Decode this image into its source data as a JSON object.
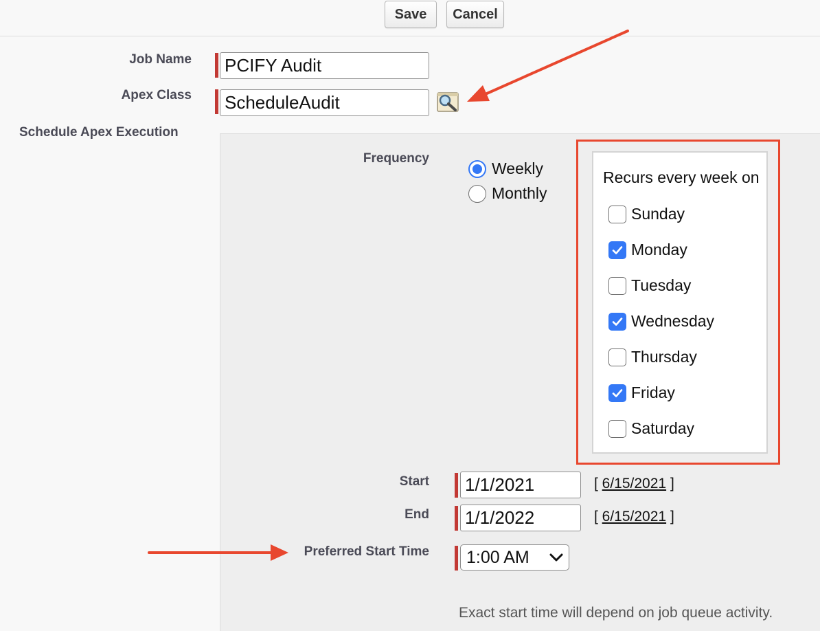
{
  "toolbar": {
    "save_label": "Save",
    "cancel_label": "Cancel"
  },
  "form": {
    "job_name": {
      "label": "Job Name",
      "value": "PCIFY Audit"
    },
    "apex_class": {
      "label": "Apex Class",
      "value": "ScheduleAudit",
      "lookup_icon": "lookup-magnifier-icon"
    },
    "schedule_label": "Schedule Apex Execution"
  },
  "schedule": {
    "frequency_label": "Frequency",
    "frequency_options": [
      {
        "label": "Weekly",
        "selected": true
      },
      {
        "label": "Monthly",
        "selected": false
      }
    ],
    "recurs_label": "Recurs every week on",
    "days": [
      {
        "label": "Sunday",
        "checked": false
      },
      {
        "label": "Monday",
        "checked": true
      },
      {
        "label": "Tuesday",
        "checked": false
      },
      {
        "label": "Wednesday",
        "checked": true
      },
      {
        "label": "Thursday",
        "checked": false
      },
      {
        "label": "Friday",
        "checked": true
      },
      {
        "label": "Saturday",
        "checked": false
      }
    ],
    "start": {
      "label": "Start",
      "value": "1/1/2021",
      "today_link": "6/15/2021"
    },
    "end": {
      "label": "End",
      "value": "1/1/2022",
      "today_link": "6/15/2021"
    },
    "preferred_start_time": {
      "label": "Preferred Start Time",
      "value": "1:00 AM"
    },
    "note": "Exact start time will depend on job queue activity."
  },
  "colors": {
    "accent": "#3478f6",
    "required": "#c23934",
    "annotation": "#e8472e"
  }
}
